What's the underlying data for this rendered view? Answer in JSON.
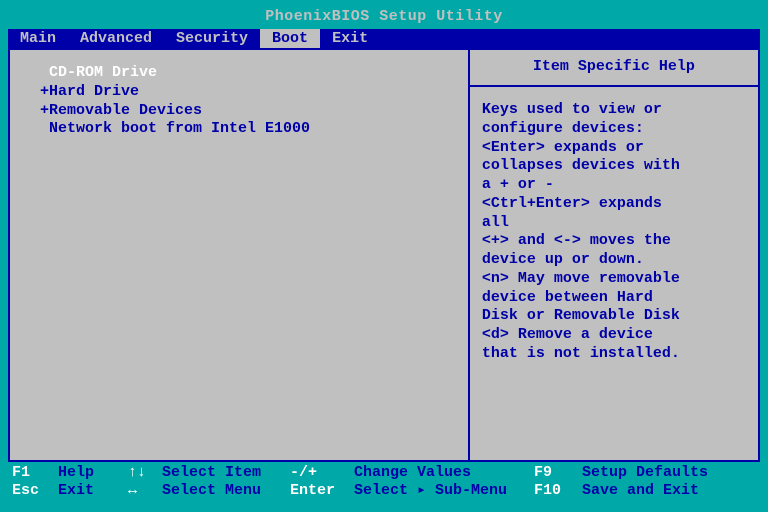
{
  "title": "PhoenixBIOS Setup Utility",
  "menu": {
    "items": [
      "Main",
      "Advanced",
      "Security",
      "Boot",
      "Exit"
    ],
    "active_index": 3
  },
  "boot_items": [
    {
      "label": "CD-ROM Drive",
      "prefix": " ",
      "selected": true
    },
    {
      "label": "Hard Drive",
      "prefix": "+",
      "selected": false
    },
    {
      "label": "Removable Devices",
      "prefix": "+",
      "selected": false
    },
    {
      "label": "Network boot from Intel E1000",
      "prefix": " ",
      "selected": false
    }
  ],
  "help": {
    "title": "Item Specific Help",
    "body": "Keys used to view or\nconfigure devices:\n<Enter> expands or\ncollapses devices with\na + or -\n<Ctrl+Enter> expands\nall\n<+> and <-> moves the\ndevice up or down.\n<n> May move removable\ndevice between Hard\nDisk or Removable Disk\n<d> Remove a device\nthat is not installed."
  },
  "footer": {
    "row1": {
      "k1": "F1",
      "l1": "Help",
      "k2": "↑↓",
      "l2": "Select Item",
      "k3": "-/+",
      "l3": "Change Values",
      "k4": "F9",
      "l4": "Setup Defaults"
    },
    "row2": {
      "k1": "Esc",
      "l1": "Exit",
      "k2": "↔",
      "l2": "Select Menu",
      "k3": "Enter",
      "l3": "Select ▸ Sub-Menu",
      "k4": "F10",
      "l4": "Save and Exit"
    }
  }
}
